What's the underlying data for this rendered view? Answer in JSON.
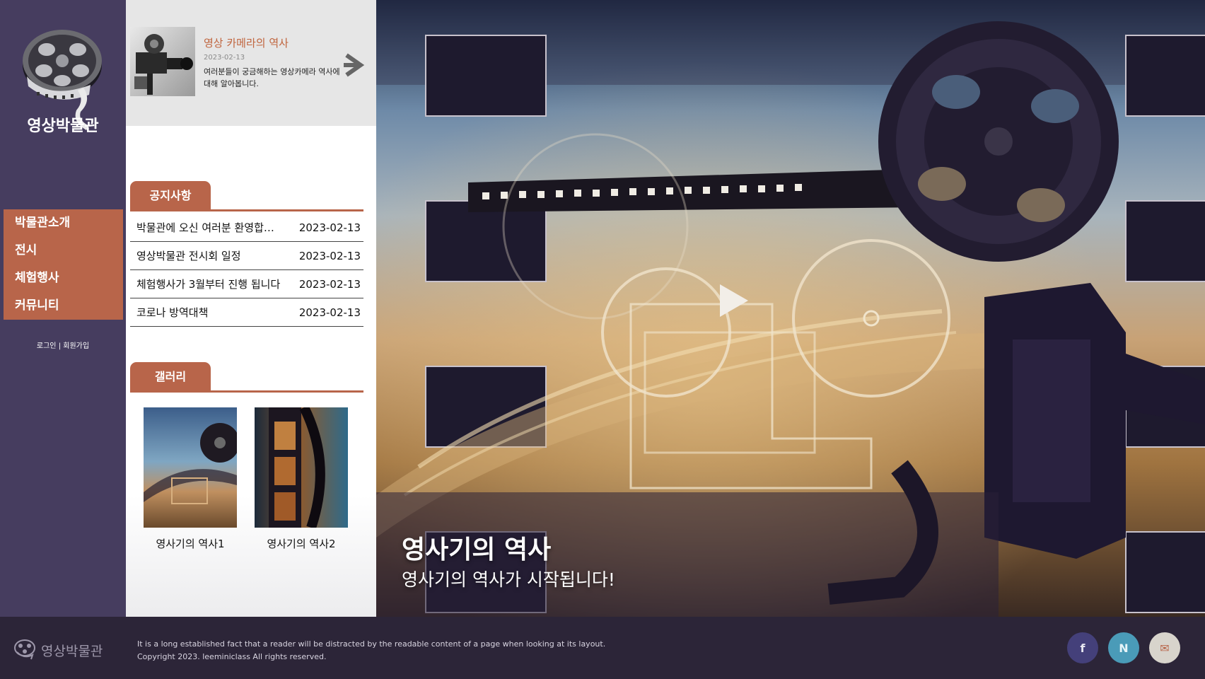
{
  "sidebar": {
    "logo_text": "영상박물관",
    "menu": [
      "박물관소개",
      "전시",
      "체험행사",
      "커뮤니티"
    ],
    "login": "로그인",
    "separator": "|",
    "signup": "회원가입"
  },
  "feature": {
    "title": "영상 카메라의 역사",
    "date": "2023-02-13",
    "description": "여러분들이 궁금해하는 영상카메라 역사에 대해 알아봅니다."
  },
  "notice": {
    "heading": "공지사항",
    "items": [
      {
        "title": "박물관에 오신 여러분 환영합니다",
        "date": "2023-02-13"
      },
      {
        "title": "영상박물관 전시회 일정",
        "date": "2023-02-13"
      },
      {
        "title": "체험행사가 3월부터 진행 됩니다",
        "date": "2023-02-13"
      },
      {
        "title": "코로나 방역대책",
        "date": "2023-02-13"
      }
    ]
  },
  "gallery": {
    "heading": "갤러리",
    "items": [
      {
        "caption": "영사기의 역사1"
      },
      {
        "caption": "영사기의 역사2"
      }
    ]
  },
  "hero": {
    "title": "영사기의 역사",
    "subtitle": "영사기의 역사가 시작됩니다!"
  },
  "footer": {
    "brand": "영상박물관",
    "line1": "It is a long established fact that a reader will be distracted by the readable content of a page when looking at its layout.",
    "line2": "Copyright 2023. leeminiclass All rights reserved.",
    "social": [
      {
        "label": "f",
        "bg": "#44407a",
        "fg": "#e6e6f0"
      },
      {
        "label": "N",
        "bg": "#4a9bb8",
        "fg": "#e6f4f8"
      },
      {
        "label": "✉",
        "bg": "#d8d4cc",
        "fg": "#b8654a"
      }
    ]
  },
  "colors": {
    "accent": "#b8654a",
    "sidebar": "#463d5f",
    "footer": "#2c2538"
  }
}
